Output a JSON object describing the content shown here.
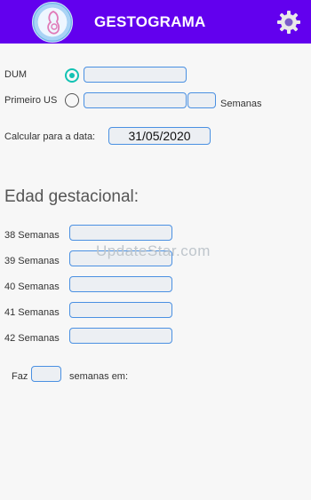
{
  "appbar": {
    "title": "GESTOGRAMA",
    "logo_icon": "pregnancy-logo-icon",
    "settings_icon": "gear-icon"
  },
  "form": {
    "dum_label": "DUM",
    "primeiro_us_label": "Primeiro US",
    "semanas_label": "Semanas",
    "calcular_label": "Calcular para a data:",
    "date_value": "31/05/2020"
  },
  "results": {
    "heading": "Edad gestacional:",
    "rows": [
      {
        "label": "38 Semanas"
      },
      {
        "label": "39 Semanas"
      },
      {
        "label": "40 Semanas"
      },
      {
        "label": "41 Semanas"
      },
      {
        "label": "42 Semanas"
      }
    ]
  },
  "footer": {
    "faz_label": "Faz",
    "semanas_em_label": "semanas em:"
  },
  "watermark": "UpdateStar.com",
  "colors": {
    "primary": "#6200ee",
    "accent": "#12c2b3",
    "field_border": "#4a90e2"
  }
}
